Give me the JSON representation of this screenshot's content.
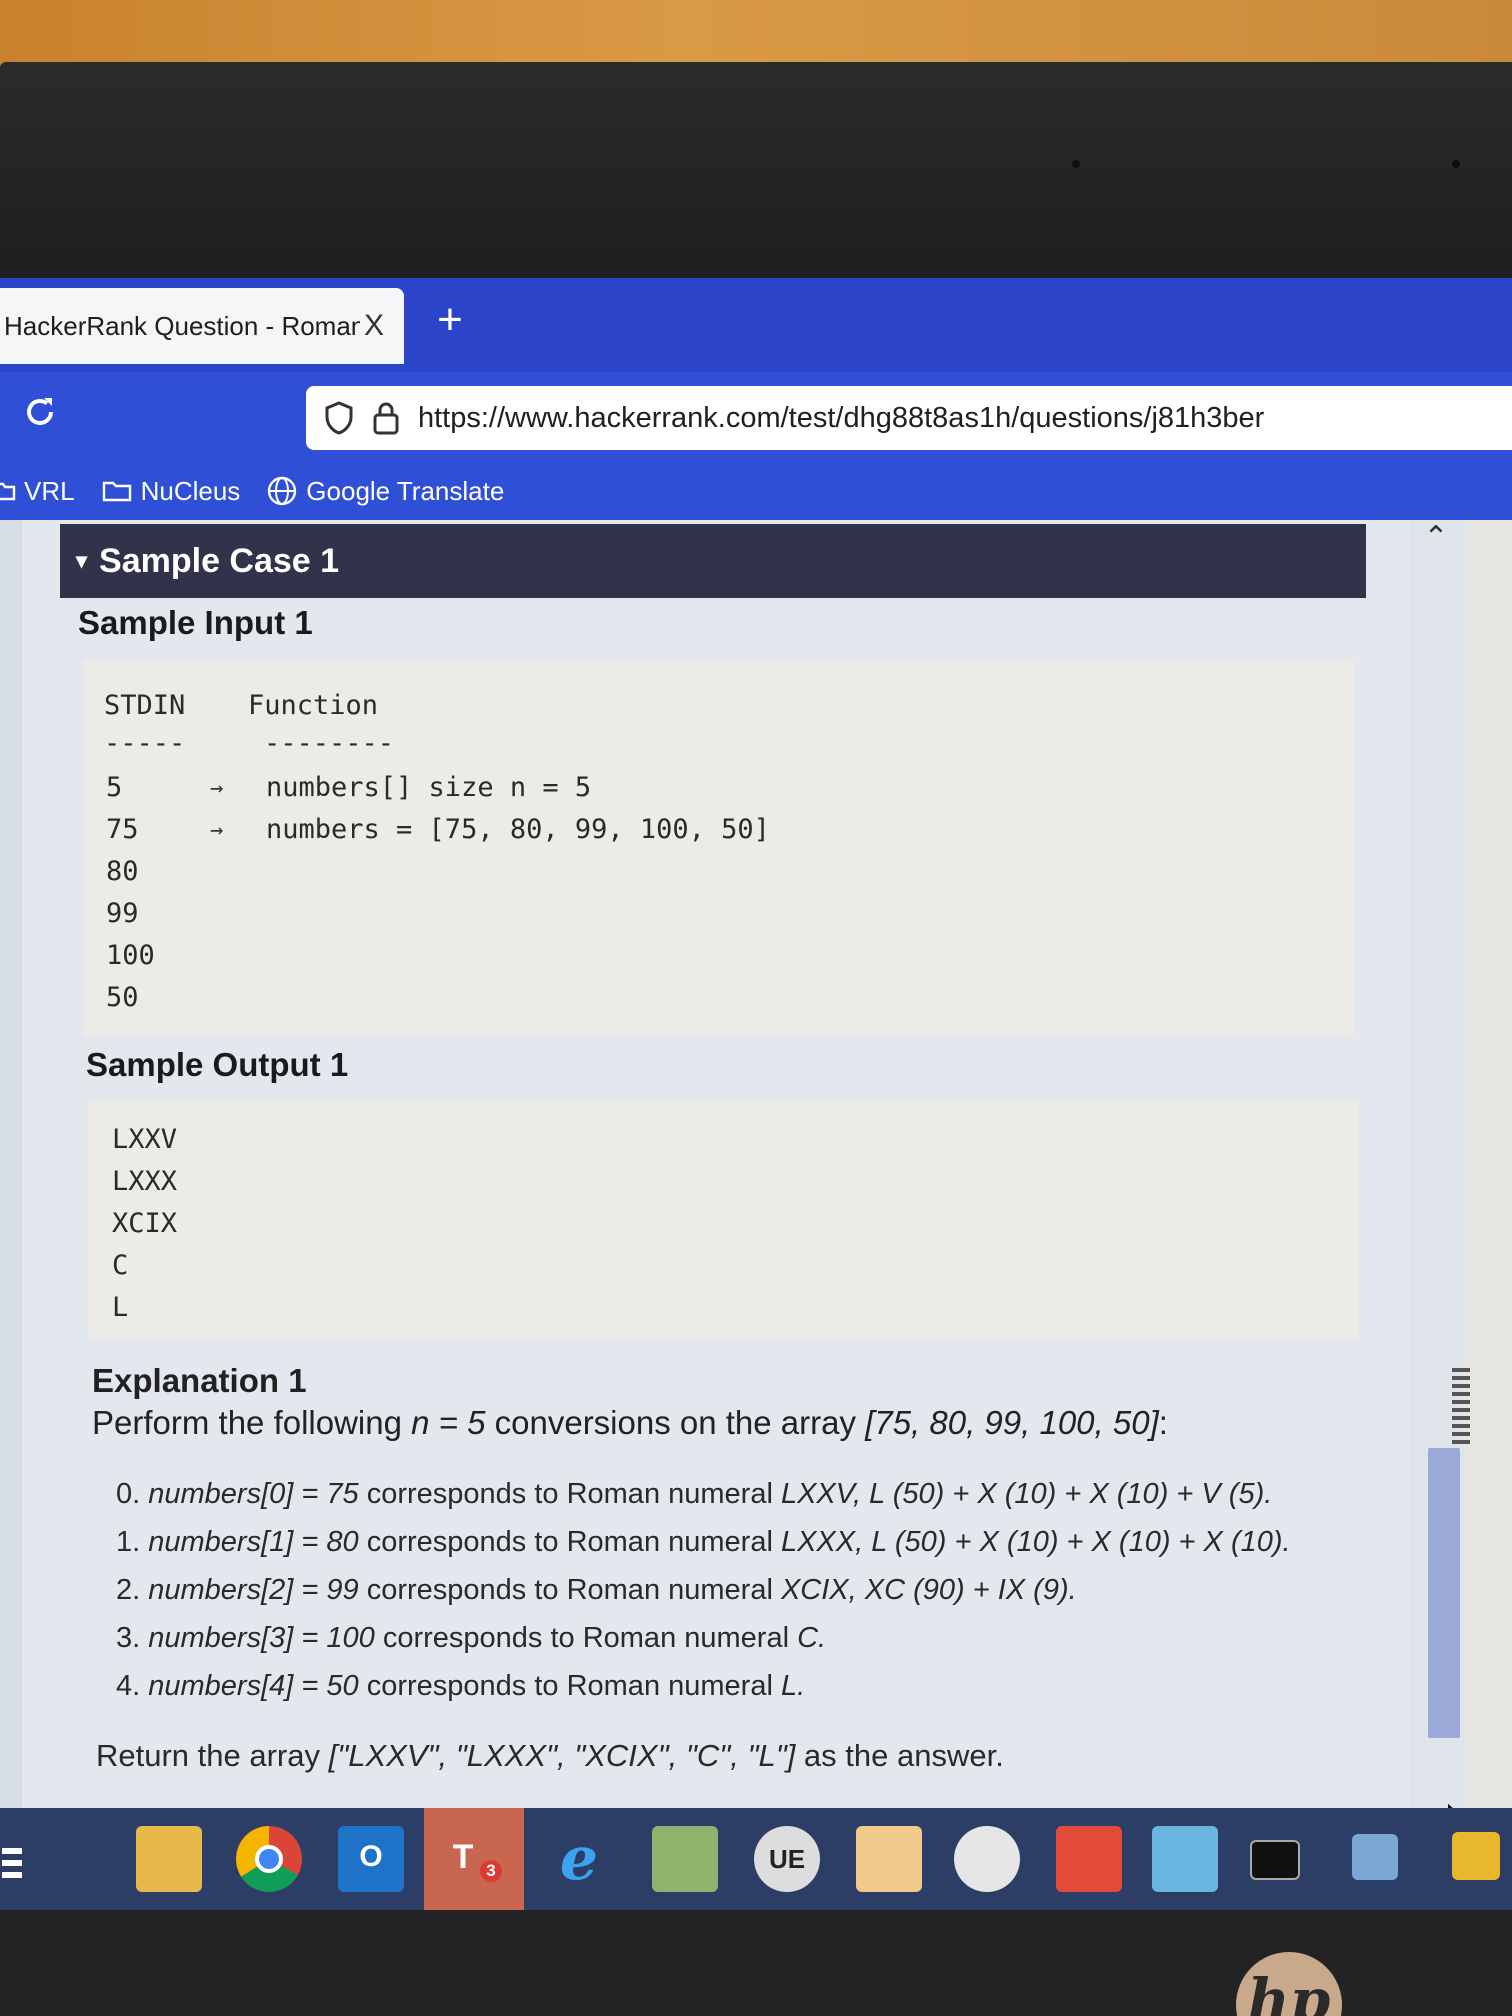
{
  "browser": {
    "tab_title": "HackerRank Question - Romani",
    "tab_close": "X",
    "new_tab": "+",
    "url": "https://www.hackerrank.com/test/dhg88t8as1h/questions/j81h3ber",
    "bookmarks": [
      "VRL",
      "NuCleus",
      "Google Translate"
    ]
  },
  "sample_case": {
    "header": "Sample Case 1",
    "toggle": "▾",
    "input_title": "Sample Input 1",
    "stdin_header": "STDIN",
    "function_header": "Function",
    "stdin_divider": "-----",
    "function_divider": "--------",
    "input_lines": [
      "5",
      "75",
      "80",
      "99",
      "100",
      "50"
    ],
    "arrow": "→",
    "function_lines": [
      "numbers[] size n = 5",
      "numbers = [75, 80, 99, 100, 50]"
    ],
    "output_title": "Sample Output 1",
    "output_lines": [
      "LXXV",
      "LXXX",
      "XCIX",
      "C",
      "L"
    ]
  },
  "explanation": {
    "title": "Explanation 1",
    "intro_pre": "Perform the following ",
    "intro_var": "n = 5",
    "intro_mid": " conversions on the array ",
    "intro_arr": "[75, 80, 99, 100, 50]",
    "intro_end": ":",
    "steps": [
      {
        "num": "0. ",
        "expr": "numbers[0] = 75",
        "text": " corresponds to Roman numeral ",
        "detail": "LXXV, L (50) + X (10)  + X (10) + V (5)."
      },
      {
        "num": "1. ",
        "expr": "numbers[1] = 80",
        "text": " corresponds to Roman numeral ",
        "detail": "LXXX, L (50) + X (10)  + X (10) + X (10)."
      },
      {
        "num": "2. ",
        "expr": "numbers[2] = 99",
        "text": " corresponds to Roman numeral ",
        "detail": "XCIX, XC (90) + IX (9)."
      },
      {
        "num": "3. ",
        "expr": "numbers[3] = 100",
        "text": " corresponds to Roman numeral ",
        "detail": "C."
      },
      {
        "num": "4. ",
        "expr": "numbers[4] = 50",
        "text": " corresponds to Roman numeral ",
        "detail": "L."
      }
    ],
    "answer_pre": "Return the array ",
    "answer_arr": "[\"LXXV\", \"LXXX\", \"XCIX\", \"C\", \"L\"]",
    "answer_post": " as the answer."
  },
  "taskbar": {
    "teams_badge": "3",
    "laptop_brand": "hp"
  },
  "colors": {
    "tabstrip": "#2b44c9",
    "toolbar": "#2f4fd6",
    "case_header": "#32334a",
    "codebox": "#ecebe7",
    "taskbar": "#2c3e66"
  }
}
